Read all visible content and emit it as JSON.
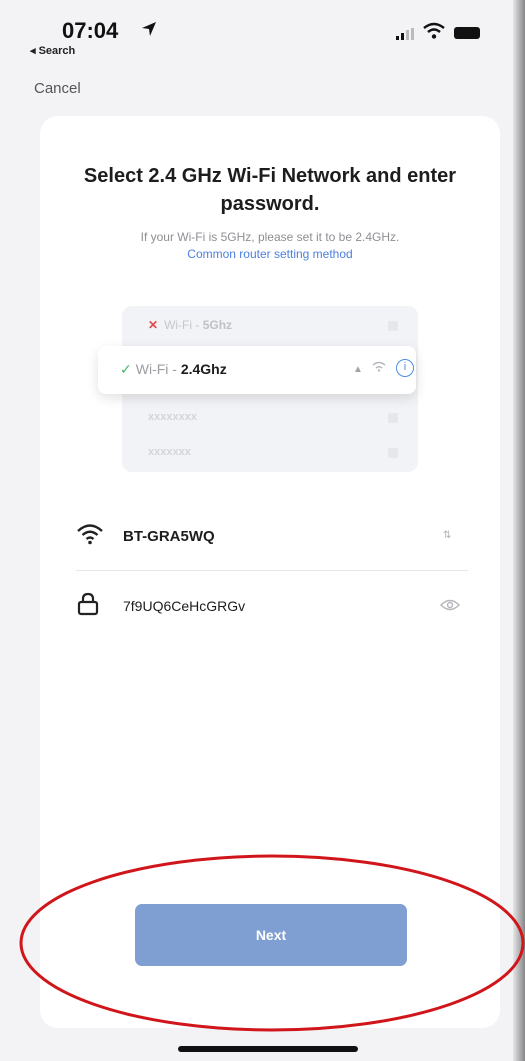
{
  "status_bar": {
    "time": "07:04",
    "back_label": "◂ Search"
  },
  "nav": {
    "cancel_label": "Cancel"
  },
  "header": {
    "title": "Select 2.4 GHz Wi-Fi Network and enter password.",
    "subtitle": "If your Wi-Fi is 5GHz, please set it to be 2.4GHz.",
    "router_link": "Common router setting method"
  },
  "illustration": {
    "row_5g_prefix": "Wi-Fi - ",
    "row_5g_bold": "5Ghz",
    "row_24_prefix": "Wi-Fi - ",
    "row_24_bold": "2.4Ghz",
    "blur_1": "xxxxxxxx",
    "blur_2": "xxxxxxx"
  },
  "form": {
    "ssid": "BT-GRA5WQ",
    "switch_label": "⇅",
    "password": "7f9UQ6CeHcGRGv"
  },
  "actions": {
    "next_label": "Next"
  },
  "colors": {
    "accent": "#7f9fd3",
    "link": "#4c7fe0",
    "annotation": "#d0161b"
  }
}
